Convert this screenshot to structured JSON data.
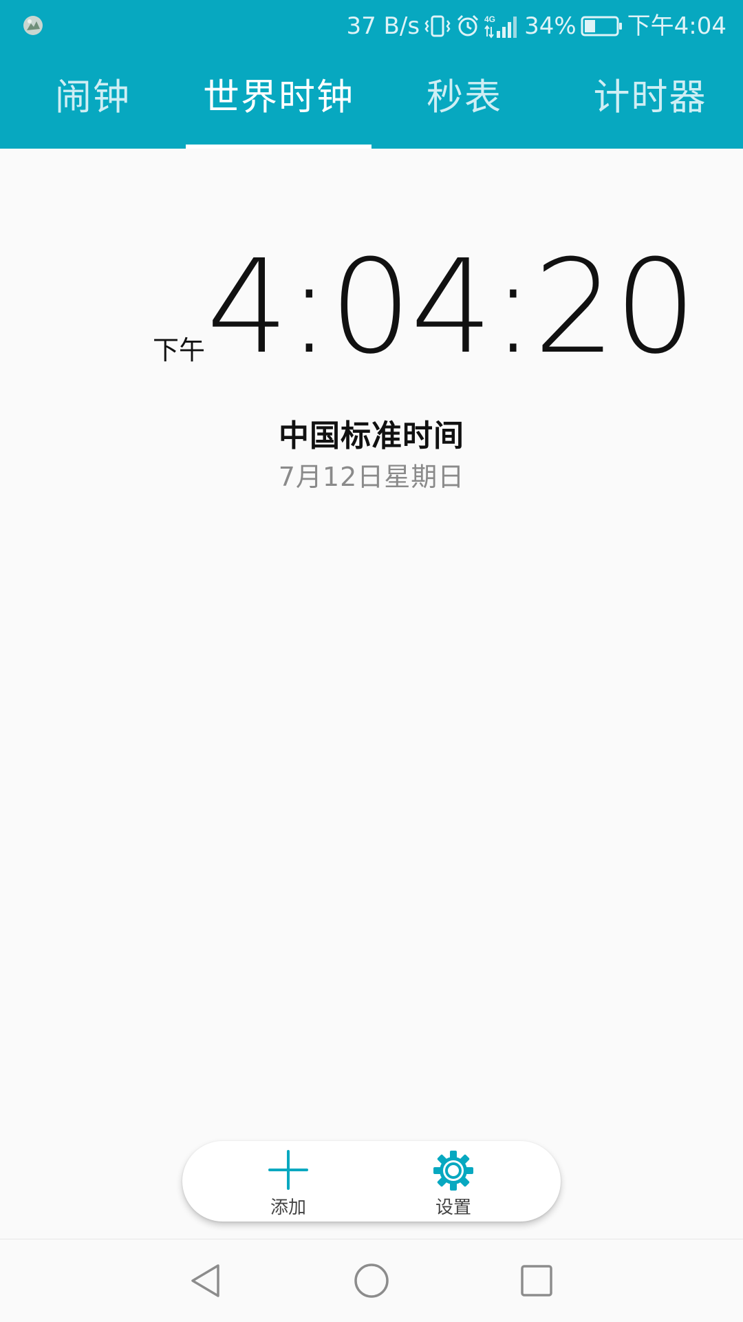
{
  "status_bar": {
    "network_speed": "37 B/s",
    "battery_percent": "34%",
    "battery_level": 0.34,
    "time": "下午4:04",
    "network_type": "4G",
    "icons": [
      "avatar-icon",
      "vibrate-icon",
      "alarm-icon",
      "signal-icon",
      "battery-icon"
    ]
  },
  "tabs": [
    {
      "label": "闹钟",
      "active": false
    },
    {
      "label": "世界时钟",
      "active": true
    },
    {
      "label": "秒表",
      "active": false
    },
    {
      "label": "计时器",
      "active": false
    }
  ],
  "clock": {
    "ampm": "下午",
    "time": "4:04:20",
    "zone": "中国标准时间",
    "date": "7月12日星期日"
  },
  "actions": {
    "add_label": "添加",
    "settings_label": "设置",
    "add_icon": "plus-icon",
    "settings_icon": "gear-icon"
  },
  "navigation": {
    "icons": [
      "back-icon",
      "home-icon",
      "recent-apps-icon"
    ]
  },
  "colors": {
    "accent": "#07a8c0",
    "tab_inactive": "#cfeef4",
    "background": "#fafafa"
  }
}
